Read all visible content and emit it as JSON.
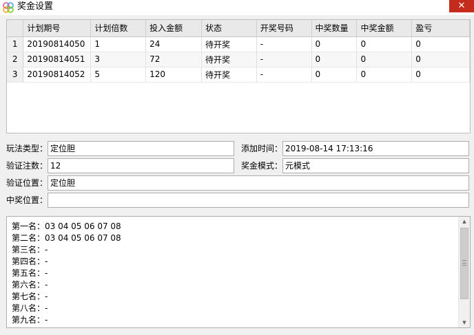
{
  "window": {
    "title": "奖金设置",
    "close_glyph": "✕"
  },
  "grid": {
    "columns": [
      "计划期号",
      "计划倍数",
      "投入金额",
      "状态",
      "开奖号码",
      "中奖数量",
      "中奖金额",
      "盈亏"
    ],
    "rows": [
      {
        "num": "1",
        "cells": [
          "20190814050",
          "1",
          "24",
          "待开奖",
          "-",
          "0",
          "0",
          "0"
        ]
      },
      {
        "num": "2",
        "cells": [
          "20190814051",
          "3",
          "72",
          "待开奖",
          "-",
          "0",
          "0",
          "0"
        ]
      },
      {
        "num": "3",
        "cells": [
          "20190814052",
          "5",
          "120",
          "待开奖",
          "-",
          "0",
          "0",
          "0"
        ]
      }
    ]
  },
  "form": {
    "play_type_label": "玩法类型：",
    "play_type_value": "定位胆",
    "add_time_label": "添加时间：",
    "add_time_value": "2019-08-14 17:13:16",
    "verify_count_label": "验证注数：",
    "verify_count_value": "12",
    "prize_mode_label": "奖金模式：",
    "prize_mode_value": "元模式",
    "verify_position_label": "验证位置：",
    "verify_position_value": "定位胆",
    "win_position_label": "中奖位置：",
    "win_position_value": ""
  },
  "memo": {
    "lines": [
      "第一名：03 04 05 06 07 08",
      "第二名：03 04 05 06 07 08",
      "第三名：-",
      "第四名：-",
      "第五名：-",
      "第六名：-",
      "第七名：-",
      "第八名：-",
      "第九名：-"
    ]
  },
  "colors": {
    "close_button": "#c42b1c",
    "client_bg": "#f0f0f0",
    "grid_header": "#e9e9e9"
  },
  "icons": {
    "app": "app-logo-icon",
    "close": "close-icon",
    "scroll_up": "scroll-up-arrow-icon",
    "scroll_down": "scroll-down-arrow-icon"
  }
}
